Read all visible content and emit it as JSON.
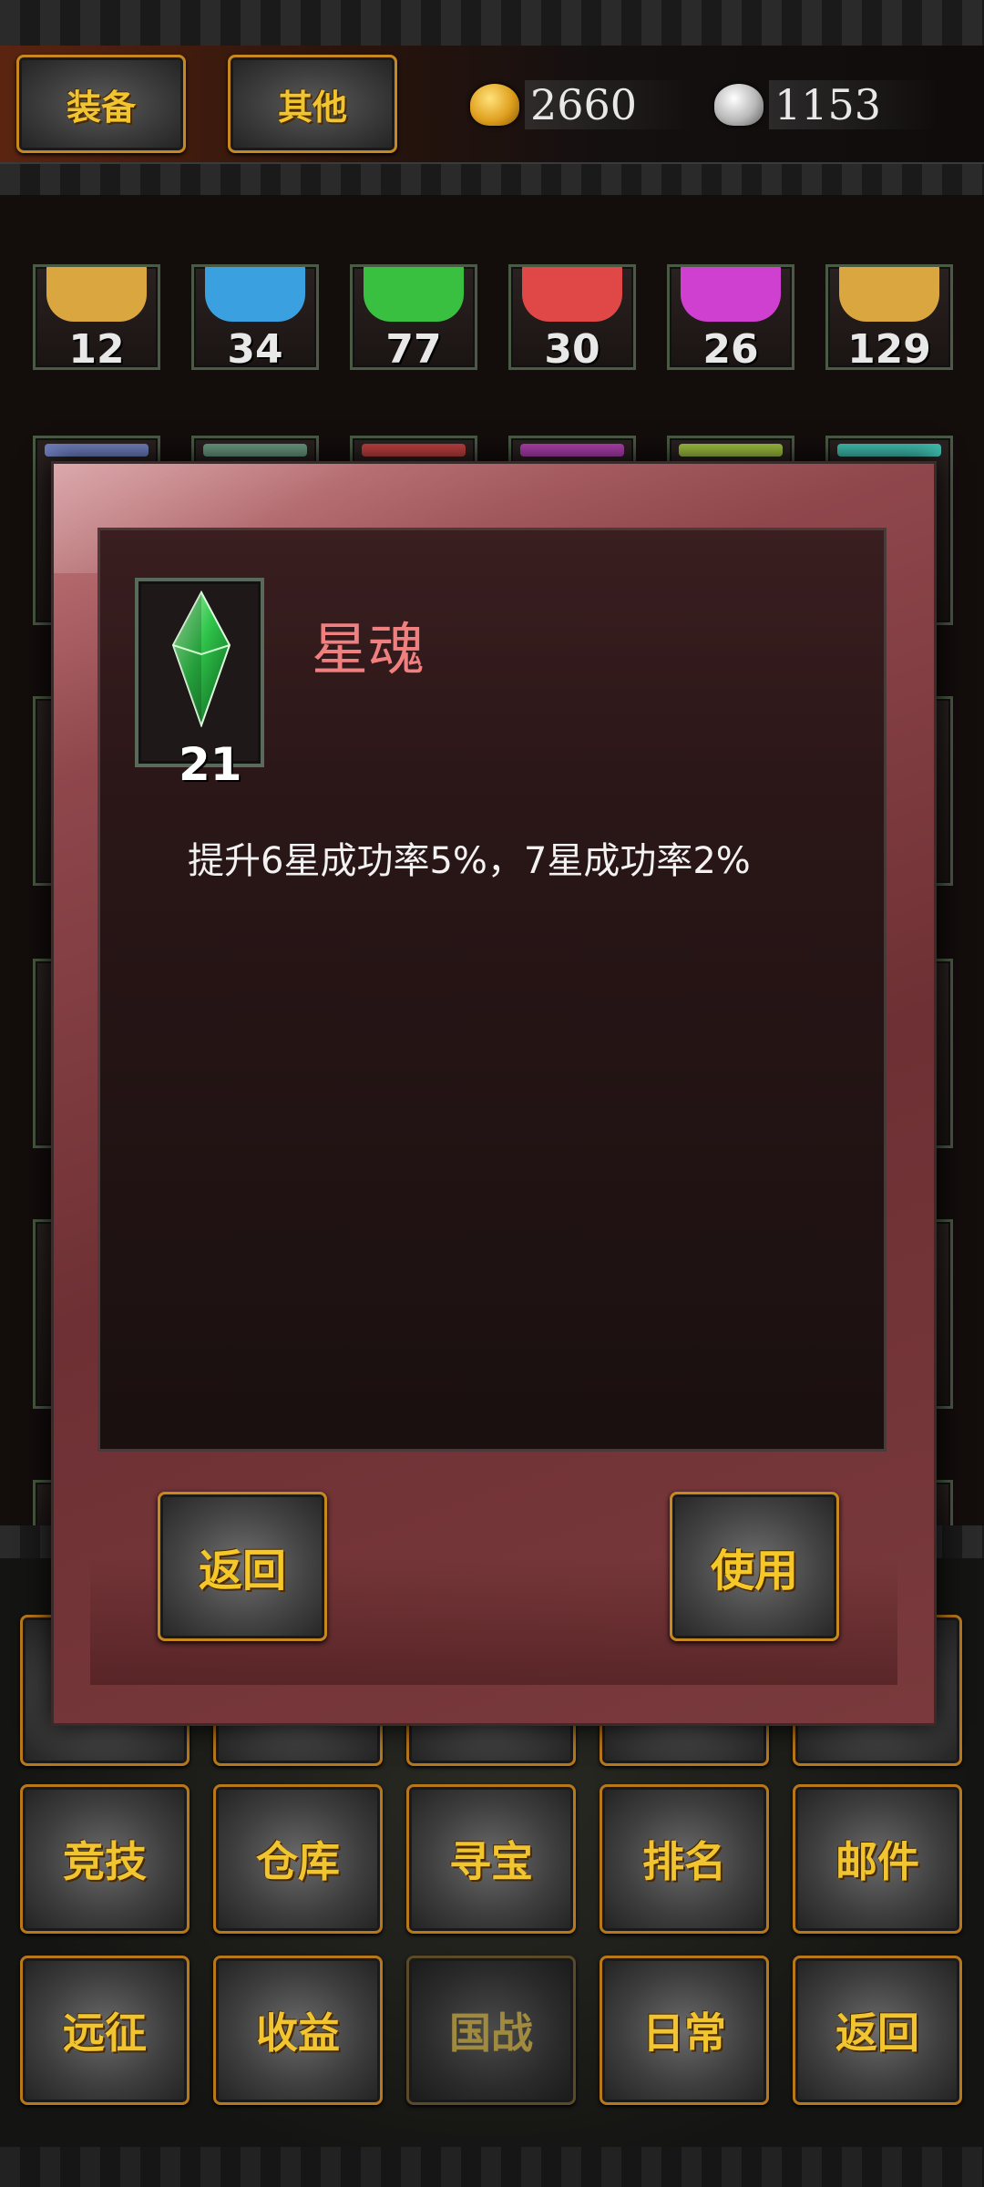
{
  "header": {
    "tabs": [
      {
        "label": "装备"
      },
      {
        "label": "其他"
      }
    ],
    "gold": {
      "value": "2660",
      "icon": "gold-ingot-icon"
    },
    "silver": {
      "value": "1153",
      "icon": "silver-ingot-icon"
    }
  },
  "inventory": {
    "row1_counts": [
      "12",
      "34",
      "77",
      "30",
      "26",
      "129"
    ],
    "row1_colors": [
      "#d9a640",
      "#3aa0e0",
      "#3ac040",
      "#e04848",
      "#d040d0",
      "#d9a640"
    ],
    "row2_colors": [
      "#7080c0",
      "#6a9a80",
      "#c04040",
      "#b040b0",
      "#a0c040",
      "#40c0b0"
    ]
  },
  "modal": {
    "item_name": "星魂",
    "item_count": "21",
    "item_icon": "green-gem-icon",
    "description": "提升6星成功率5%，7星成功率2%",
    "back_label": "返回",
    "use_label": "使用"
  },
  "menu": {
    "row2": [
      "竞技",
      "仓库",
      "寻宝",
      "排名",
      "邮件"
    ],
    "row3": [
      "远征",
      "收益",
      "国战",
      "日常",
      "返回"
    ]
  },
  "colors": {
    "button_text": "#f0c530",
    "button_border": "#c7891f",
    "item_name": "#f08080"
  }
}
